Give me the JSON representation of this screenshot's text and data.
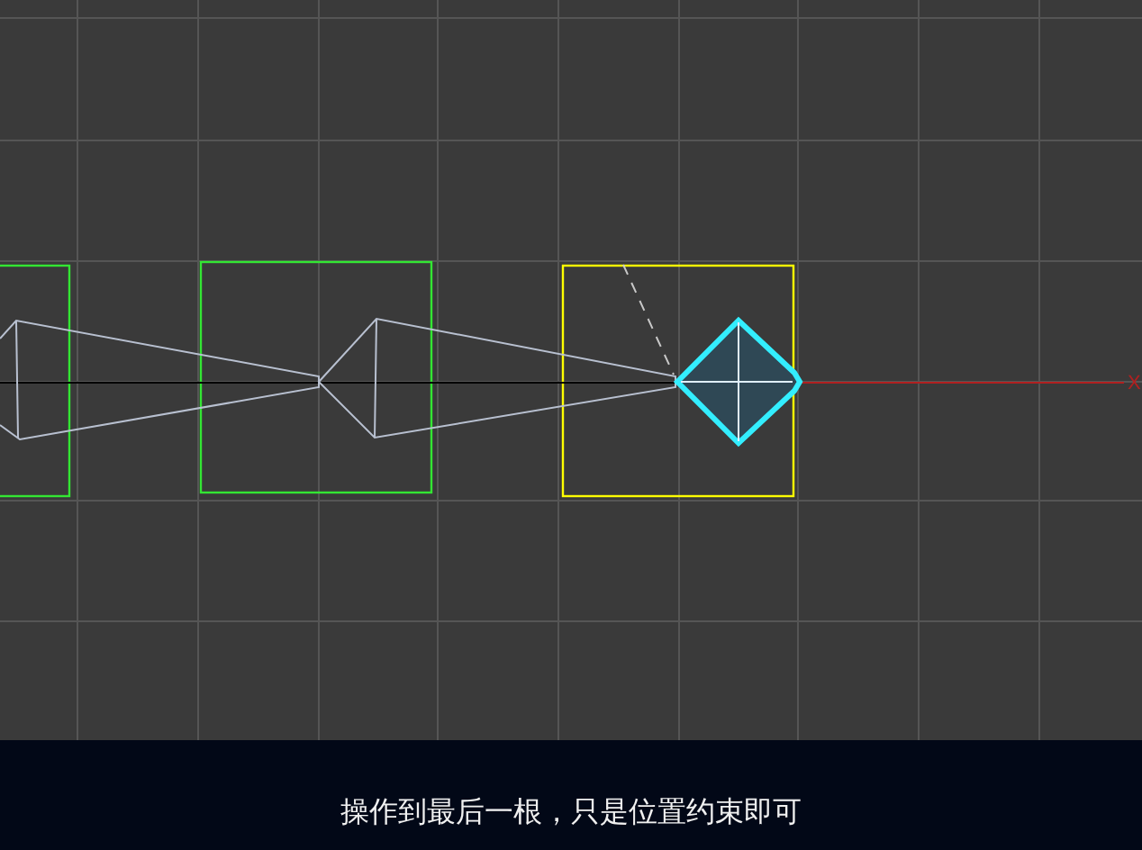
{
  "viewport": {
    "controls": [
      {
        "color": "#33e633"
      },
      {
        "color": "#33e633"
      },
      {
        "color": "#ffff00"
      }
    ],
    "axis_label": "X"
  },
  "subtitle": "操作到最后一根，只是位置约束即可"
}
